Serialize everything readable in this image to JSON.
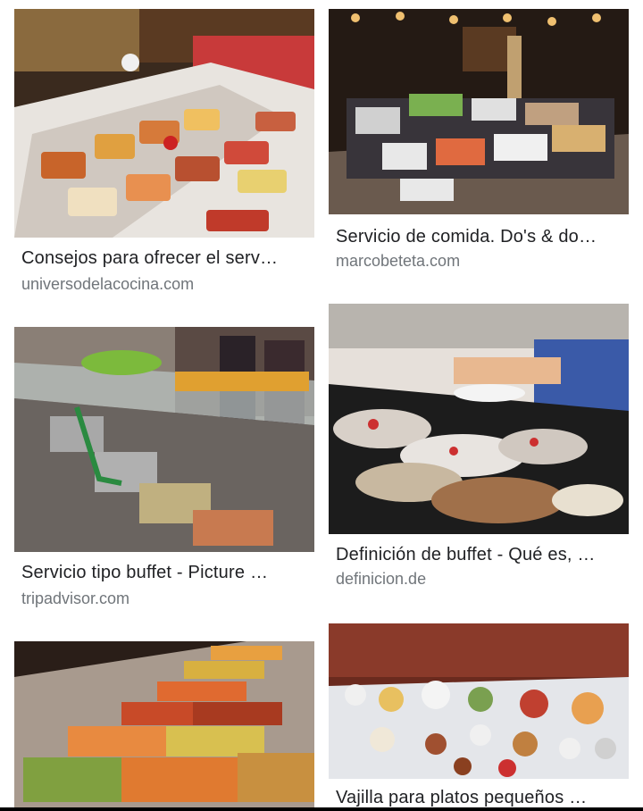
{
  "results": [
    {
      "title": "Consejos para ofrecer el serv…",
      "source": "universodelacocina.com",
      "image": "buffet-table-food-trays"
    },
    {
      "title": "Servicio de comida. Do's & do…",
      "source": "marcobeteta.com",
      "image": "buffet-dark-venue"
    },
    {
      "title": "Servicio tipo buffet - Picture …",
      "source": "tripadvisor.com",
      "image": "buffet-sneeze-guard-line"
    },
    {
      "title": "Definición de buffet - Qué es, …",
      "source": "definicion.de",
      "image": "person-serving-buffet"
    },
    {
      "title": "",
      "source": "",
      "image": "steam-table-trays"
    },
    {
      "title": "Vajilla para platos pequeños …",
      "source": "",
      "image": "small-plates-dessert-buffet"
    }
  ]
}
